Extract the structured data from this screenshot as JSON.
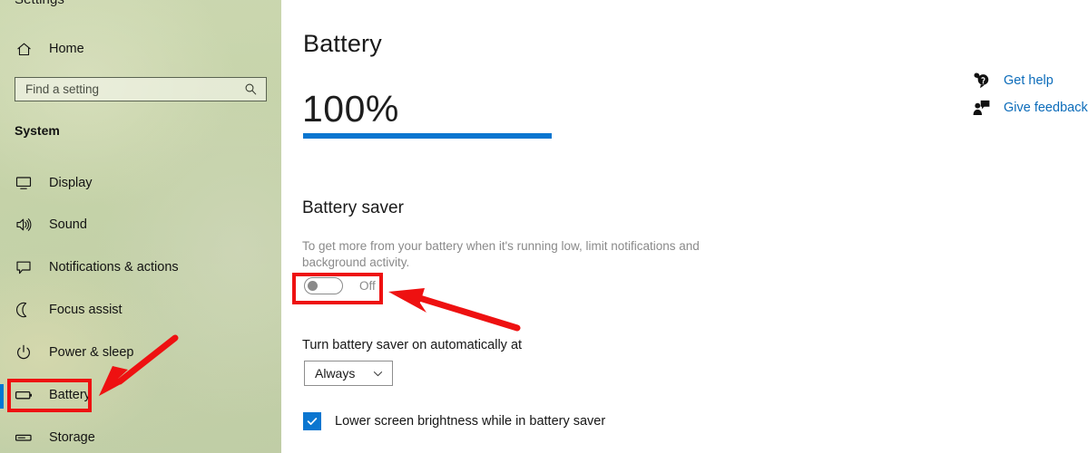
{
  "app": {
    "title": "Settings"
  },
  "sidebar": {
    "home_label": "Home",
    "home_icon": "home-icon",
    "search": {
      "placeholder": "Find a setting",
      "value": "",
      "icon": "search-icon"
    },
    "group_heading": "System",
    "items": [
      {
        "label": "Display",
        "icon": "monitor-icon",
        "selected": false
      },
      {
        "label": "Sound",
        "icon": "speaker-icon",
        "selected": false
      },
      {
        "label": "Notifications & actions",
        "icon": "chat-bubble-icon",
        "selected": false
      },
      {
        "label": "Focus assist",
        "icon": "moon-icon",
        "selected": false
      },
      {
        "label": "Power & sleep",
        "icon": "power-icon",
        "selected": false
      },
      {
        "label": "Battery",
        "icon": "battery-icon",
        "selected": true
      },
      {
        "label": "Storage",
        "icon": "drive-icon",
        "selected": false
      }
    ],
    "selected_accent": "#0078d4",
    "background_color": "#c6d3a9"
  },
  "main": {
    "page_title": "Battery",
    "battery_level_text": "100%",
    "battery_level_percent": 100,
    "battery_bar_color": "#0b76d0",
    "battery_saver": {
      "heading": "Battery saver",
      "description": "To get more from your battery when it's running low, limit notifications and background activity.",
      "toggle_state_label": "Off",
      "toggle_on": false,
      "auto_label": "Turn battery saver on automatically at",
      "auto_value": "Always",
      "auto_options": [
        "Always"
      ],
      "dropdown_icon": "chevron-down-icon",
      "brightness_label": "Lower screen brightness while in battery saver",
      "brightness_checked": true,
      "checkbox_color": "#0b76d0"
    }
  },
  "right_links": {
    "link_color": "#0c6cba",
    "items": [
      {
        "label": "Get help",
        "icon": "help-bubble-icon"
      },
      {
        "label": "Give feedback",
        "icon": "feedback-person-icon"
      }
    ]
  },
  "annotations": {
    "color": "#ee1111",
    "highlights": [
      {
        "name": "battery-nav-highlight",
        "target": "sidebar Battery item"
      },
      {
        "name": "battery-saver-toggle-highlight",
        "target": "battery saver toggle"
      }
    ],
    "arrows": [
      {
        "name": "arrow-to-battery-nav",
        "points_to": "sidebar Battery item"
      },
      {
        "name": "arrow-to-toggle",
        "points_to": "battery saver toggle"
      }
    ]
  }
}
